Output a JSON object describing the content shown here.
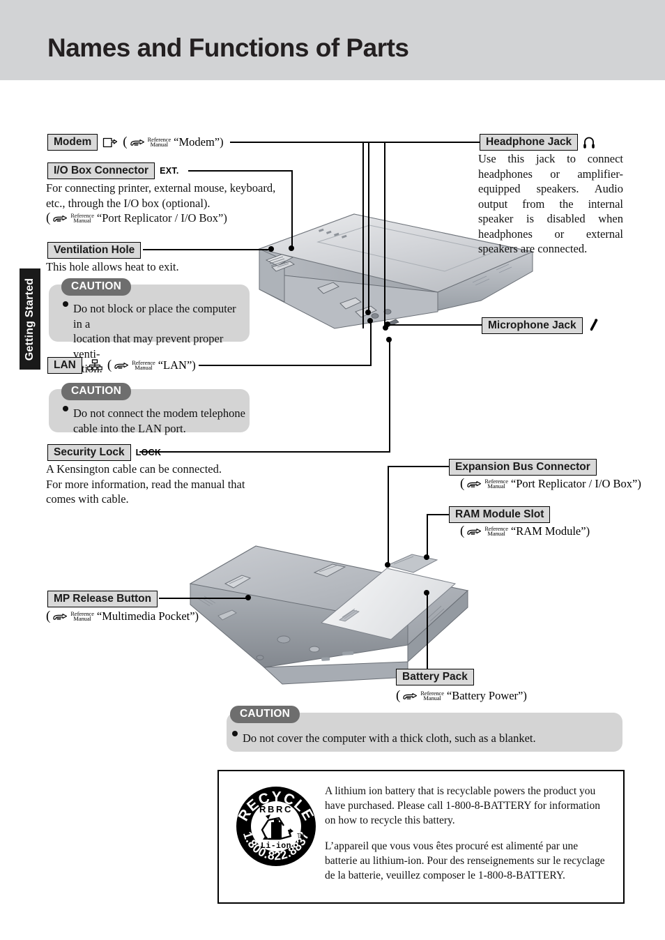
{
  "page": {
    "title": "Names and Functions of Parts",
    "side_tab": "Getting Started"
  },
  "reference_glyph": {
    "line1": "Reference",
    "line2": "Manual",
    "hand_icon": "pointing-hand-icon"
  },
  "sections": {
    "modem": {
      "label": "Modem",
      "icon": "modem-port-icon",
      "reference": "“Modem”)"
    },
    "io_box": {
      "label": "I/O Box Connector",
      "port_mark": "EXT.",
      "body_line1": "For connecting printer, external mouse, keyboard,",
      "body_line2": "etc., through the I/O box (optional).",
      "reference": "“Port Replicator / I/O Box”)"
    },
    "ventilation": {
      "label": "Ventilation Hole",
      "body": "This hole allows heat to exit.",
      "caution": {
        "title": "CAUTION",
        "items": [
          "Do not block or place the computer in a location that may prevent proper venti-lation."
        ],
        "item_lines": [
          "Do not block or place the computer in a",
          "location that may prevent proper venti-",
          "lation."
        ]
      }
    },
    "lan": {
      "label": "LAN",
      "icon": "lan-network-icon",
      "reference": "“LAN”)",
      "caution": {
        "title": "CAUTION",
        "item_lines": [
          "Do not connect the modem telephone",
          "cable into the LAN port."
        ]
      }
    },
    "security_lock": {
      "label": "Security Lock",
      "port_mark": "LOCK",
      "body_line1": "A Kensington cable can be connected.",
      "body_line2": "For more information, read the manual that",
      "body_line3": "comes with cable."
    },
    "headphone": {
      "label": "Headphone Jack",
      "icon": "headphone-icon",
      "body": "Use this jack to connect  headphones or amplifier-equipped speakers. Audio output from the internal speaker is disabled when headphones or external speakers are connected."
    },
    "microphone": {
      "label": "Microphone Jack",
      "icon": "microphone-icon"
    },
    "expansion_bus": {
      "label": "Expansion Bus Connector",
      "reference": "“Port Replicator / I/O Box”)"
    },
    "ram_module": {
      "label": "RAM Module Slot",
      "reference": "“RAM Module”)"
    },
    "mp_release": {
      "label": "MP Release Button",
      "reference": "“Multimedia Pocket”)"
    },
    "battery_pack": {
      "label": "Battery Pack",
      "reference": "“Battery Power”)"
    }
  },
  "bottom_caution": {
    "title": "CAUTION",
    "item": "Do not cover the computer with a thick cloth, such as a blanket."
  },
  "recycle": {
    "seal": {
      "top_arc": "RECYCLE",
      "bottom_arc": "1.800.822.8837",
      "center_text": "RBRC",
      "chemistry": "Li-ion",
      "tm": "TM",
      "icon": "rbrc-recycle-seal-icon"
    },
    "paragraph_en": "A lithium ion battery that is recyclable powers the product you have purchased.  Please call 1-800-8-BATTERY for information on how to recycle this battery.",
    "paragraph_fr": "L’appareil que vous vous êtes procuré est alimenté par une batterie au lithium-ion. Pour des renseignements sur le recyclage de la batterie, veuillez composer le 1-800-8-BATTERY."
  },
  "illustrations": {
    "top": "laptop-closed-rear-three-quarter-illustration",
    "bottom": "laptop-underside-three-quarter-illustration"
  },
  "colors": {
    "header_band": "#d2d3d5",
    "chip_fill": "#d9d9d9",
    "caution_fill": "#d4d4d4",
    "caution_pill": "#6e6e6e",
    "side_tab": "#1a1a1a"
  }
}
